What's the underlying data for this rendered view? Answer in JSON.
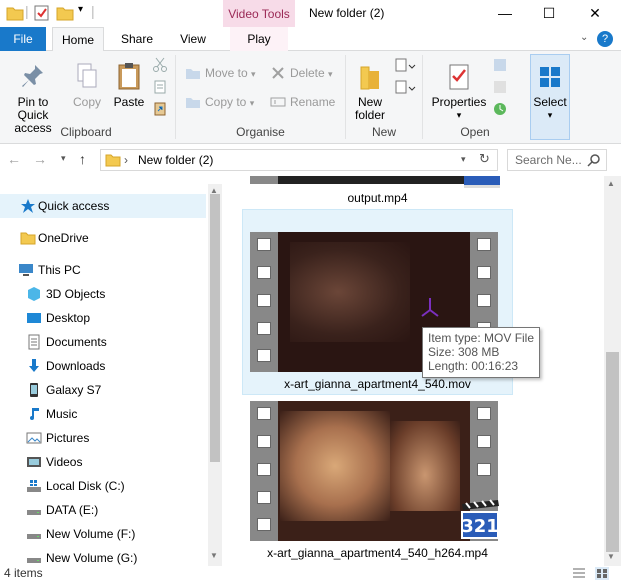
{
  "titlebar": {
    "context_tab": "Video Tools",
    "title": "New folder (2)",
    "minimize": "—",
    "maximize": "☐",
    "close": "✕"
  },
  "tabs": {
    "file": "File",
    "home": "Home",
    "share": "Share",
    "view": "View",
    "play": "Play",
    "help": "?"
  },
  "ribbon": {
    "clipboard": {
      "label": "Clipboard",
      "pin": "Pin to Quick access",
      "copy": "Copy",
      "paste": "Paste"
    },
    "organise": {
      "label": "Organise",
      "move_to": "Move to",
      "copy_to": "Copy to",
      "delete": "Delete",
      "rename": "Rename"
    },
    "new": {
      "label": "New",
      "new_folder": "New folder"
    },
    "open": {
      "label": "Open",
      "properties": "Properties"
    },
    "select": {
      "label": "Select"
    }
  },
  "address": {
    "breadcrumb_sep": "›",
    "path": "New folder (2)",
    "search_placeholder": "Search Ne..."
  },
  "nav": {
    "items": [
      {
        "label": "Quick access"
      },
      {
        "label": "OneDrive"
      },
      {
        "label": "This PC"
      },
      {
        "label": "3D Objects"
      },
      {
        "label": "Desktop"
      },
      {
        "label": "Documents"
      },
      {
        "label": "Downloads"
      },
      {
        "label": "Galaxy S7"
      },
      {
        "label": "Music"
      },
      {
        "label": "Pictures"
      },
      {
        "label": "Videos"
      },
      {
        "label": "Local Disk (C:)"
      },
      {
        "label": "DATA (E:)"
      },
      {
        "label": "New Volume (F:)"
      },
      {
        "label": "New Volume (G:)"
      }
    ]
  },
  "files": [
    {
      "name": "output.mp4"
    },
    {
      "name": "x-art_gianna_apartment4_540.mov"
    },
    {
      "name": "x-art_gianna_apartment4_540_h264.mp4"
    }
  ],
  "tooltip": {
    "type": "Item type: MOV File",
    "size": "Size: 308 MB",
    "length": "Length: 00:16:23"
  },
  "status": {
    "count": "4 items"
  },
  "colors": {
    "accent": "#1979ca",
    "context_tab_bg": "#f7dbe8",
    "selection": "#e5f3fb"
  }
}
